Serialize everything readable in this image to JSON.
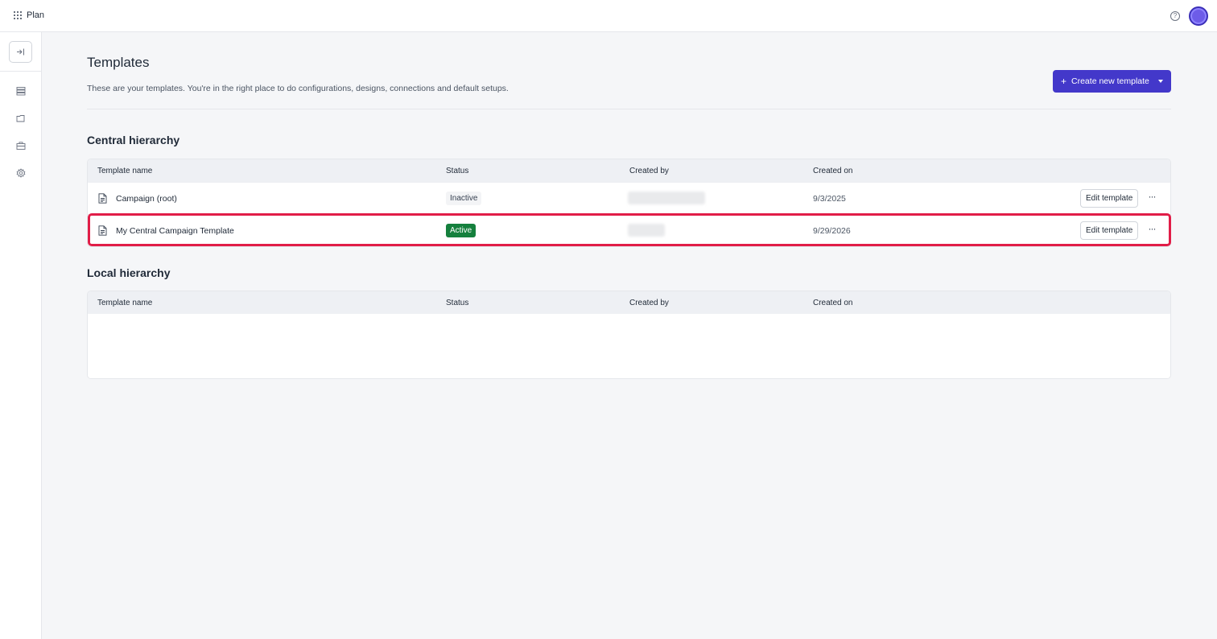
{
  "app": {
    "name": "Plan"
  },
  "topbar": {
    "help_icon": "help-circle-icon",
    "help_glyph": "?",
    "avatar_color": "#6d5ce8"
  },
  "sidebar": {
    "items": [
      {
        "name": "expand-sidebar",
        "icon": "arrow-right-to-line-icon"
      },
      {
        "name": "list",
        "icon": "list-icon"
      },
      {
        "name": "folder",
        "icon": "folder-icon"
      },
      {
        "name": "briefcase",
        "icon": "briefcase-icon"
      },
      {
        "name": "settings",
        "icon": "gear-icon"
      }
    ]
  },
  "header": {
    "title": "Templates",
    "subtitle": "These are your templates. You're in the right place to do configurations, designs, connections and default setups.",
    "create_button": {
      "label": "Create new template",
      "icon": "plus-icon",
      "plus_glyph": "+",
      "color": "#4338ca"
    }
  },
  "central": {
    "title": "Central hierarchy",
    "columns": {
      "name": "Template name",
      "status": "Status",
      "created_by": "Created by",
      "created_on": "Created on"
    },
    "rows": [
      {
        "name": "Campaign (root)",
        "status": "Inactive",
        "created_on": "9/3/2025",
        "edit_label": "Edit template",
        "more_glyph": "···"
      },
      {
        "name": "My Central Campaign Template",
        "status": "Active",
        "created_on": "9/29/2026",
        "edit_label": "Edit template",
        "more_glyph": "···"
      }
    ]
  },
  "local": {
    "title": "Local hierarchy",
    "columns": {
      "name": "Template name",
      "status": "Status",
      "created_by": "Created by",
      "created_on": "Created on"
    }
  },
  "colors": {
    "accent": "#4338ca",
    "active_badge": "#15803d",
    "highlight": "#e11d48"
  }
}
